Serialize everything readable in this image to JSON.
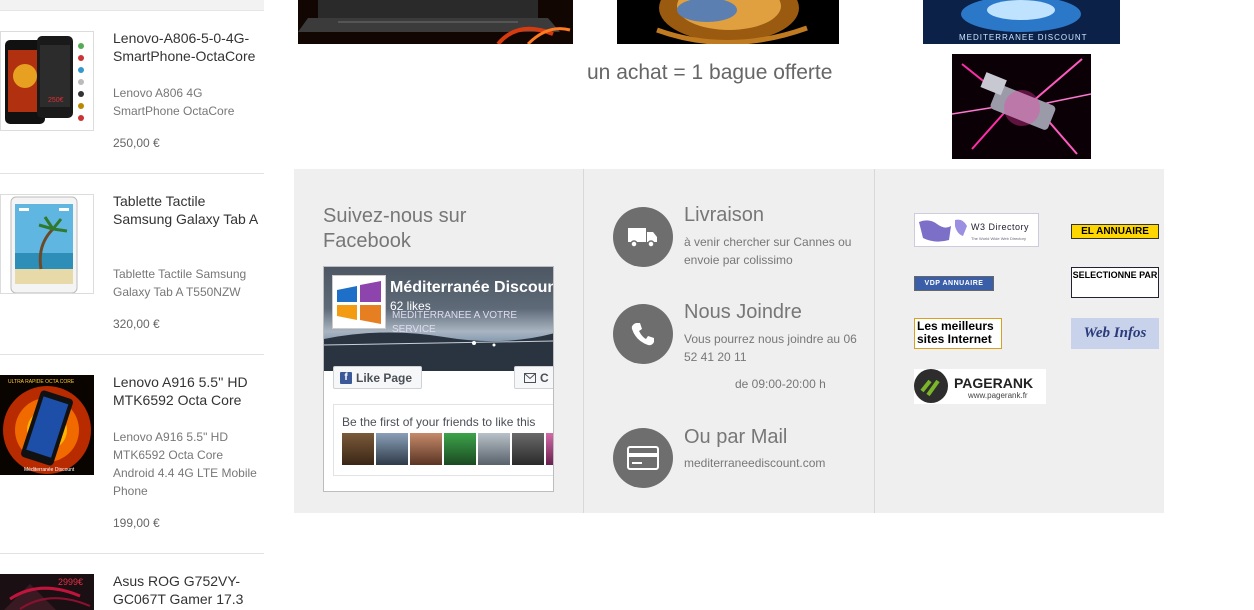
{
  "products": [
    {
      "title": "Lenovo-A806-5-0-4G-SmartPhone-OctaCore",
      "description": "Lenovo A806  4G SmartPhone  OctaCore",
      "price": "250,00 €",
      "thumb_price": "250€"
    },
    {
      "title": "Tablette Tactile Samsung Galaxy Tab A",
      "description": "Tablette Tactile Samsung Galaxy Tab A T550NZW",
      "price": "320,00 €"
    },
    {
      "title": "Lenovo A916 5.5'' HD MTK6592 Octa Core",
      "description": "Lenovo A916 5.5\" HD MTK6592 Octa Core Android 4.4 4G LTE Mobile Phone",
      "price": "199,00 €",
      "thumb_caption": "ULTRA RAPIDE OCTA CORE",
      "thumb_brand": "Méditerranée Discount"
    },
    {
      "title": "Asus ROG G752VY-GC067T Gamer 17.3",
      "thumb_price": "2999€"
    }
  ],
  "banners": {
    "promo_text": "un achat = 1 bague offerte",
    "brand_caption": "MEDITERRANEE DISCOUNT"
  },
  "facebook": {
    "heading": "Suivez-nous sur Facebook",
    "page_name": "Méditerranée Discount",
    "likes": "62 likes",
    "tagline": "MEDITERRANEE A VOTRE SERVICE",
    "like_label": "Like Page",
    "message_label": "C",
    "friends_text": "Be the first of your friends to like this"
  },
  "contact": {
    "delivery": {
      "title": "Livraison",
      "text": "à venir chercher sur Cannes ou envoie par colissimo"
    },
    "phone": {
      "title": "Nous Joindre",
      "text": "Vous pourrez nous joindre au 06 52 41 20 11",
      "hours": "de 09:00-20:00 h"
    },
    "mail": {
      "title": "Ou par Mail",
      "text": "mediterraneediscount.com"
    }
  },
  "directories": {
    "w3": "W3 Directory",
    "w3_sub": "The World Wide Web Directory",
    "el_annuaire": "EL ANNUAIRE",
    "vdp": "VDP ANNUAIRE",
    "selectionne": "SELECTIONNE PAR",
    "meilleurs": "Les meilleurs sites Internet",
    "webinfos": "Web Infos",
    "pagerank": "PAGERANK",
    "pagerank_url": "www.pagerank.fr"
  },
  "colors": {
    "footer_bg": "#efefef",
    "icon_circle": "#6e6e6e",
    "facebook_blue": "#3b5998",
    "directory_yellow": "#ffd700"
  }
}
